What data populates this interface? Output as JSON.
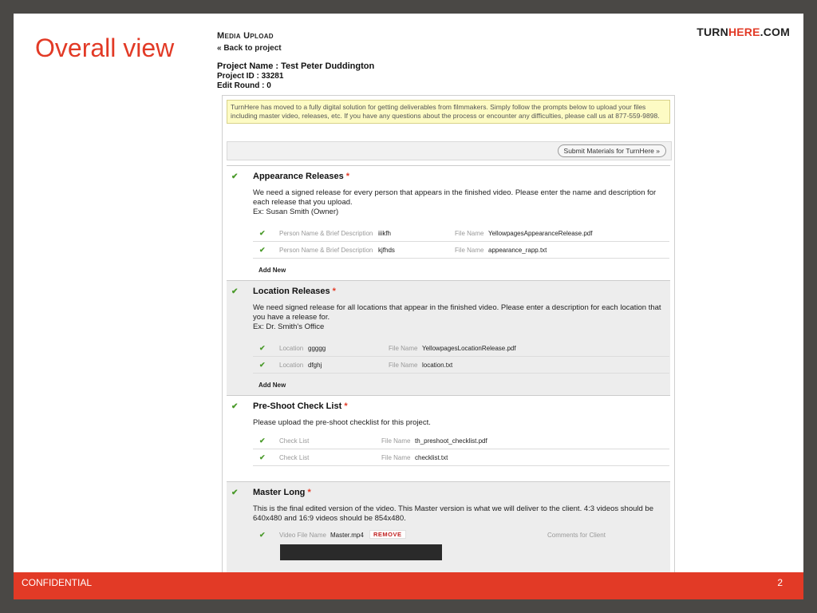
{
  "slide": {
    "title": "Overall view",
    "brand_part1": "TURN",
    "brand_part2": "HERE",
    "brand_part3": ".COM",
    "footer_left": "CONFIDENTIAL",
    "page_number": "2",
    "accent_color": "#e23a26"
  },
  "header": {
    "title": "Media Upload",
    "back_link": "« Back to project",
    "project_name": "Project Name : Test Peter Duddington",
    "project_id": "Project ID : 33281",
    "edit_round": "Edit Round : 0"
  },
  "notice": "TurnHere has moved to a fully digital solution for getting deliverables from filmmakers. Simply follow the prompts below to upload your files including master video, releases, etc. If you have any questions about the process or encounter any difficulties, please call us at 877-559-9898.",
  "submit_button": "Submit Materials for TurnHere »",
  "sections": [
    {
      "title": "Appearance Releases",
      "required": "*",
      "desc1": "We need a signed release for every person that appears in the finished video. Please enter the name and description for each release that you upload.",
      "desc2": "Ex: Susan Smith (Owner)",
      "rows": [
        {
          "label": "Person Name & Brief Description",
          "value": "iiikfh",
          "file_label": "File Name",
          "file": "YellowpagesAppearanceRelease.pdf"
        },
        {
          "label": "Person Name & Brief Description",
          "value": "kjfhds",
          "file_label": "File Name",
          "file": "appearance_rapp.txt"
        }
      ],
      "add_new": "Add New"
    },
    {
      "title": "Location Releases",
      "required": "*",
      "desc1": "We need signed release for all locations that appear in the finished video. Please enter a description for each location that you have a release for.",
      "desc2": "Ex: Dr. Smith's Office",
      "rows": [
        {
          "label": "Location",
          "value": "ggggg",
          "file_label": "File Name",
          "file": "YellowpagesLocationRelease.pdf"
        },
        {
          "label": "Location",
          "value": "dfghj",
          "file_label": "File Name",
          "file": "location.txt"
        }
      ],
      "add_new": "Add New"
    },
    {
      "title": "Pre-Shoot Check List",
      "required": "*",
      "desc1": "Please upload the pre-shoot checklist for this project.",
      "rows": [
        {
          "label": "Check List",
          "file_label": "File Name",
          "file": "th_preshoot_checklist.pdf"
        },
        {
          "label": "Check List",
          "file_label": "File Name",
          "file": "checklist.txt"
        }
      ]
    },
    {
      "title": "Master Long",
      "required": "*",
      "desc1": "This is the final edited version of the video. This Master version is what we will deliver to the client. 4:3 videos should be 640x480 and 16:9 videos should be 854x480.",
      "rows": [
        {
          "label": "Video File Name",
          "value": "Master.mp4",
          "remove": "REMOVE",
          "comments_label": "Comments for Client"
        }
      ]
    }
  ]
}
